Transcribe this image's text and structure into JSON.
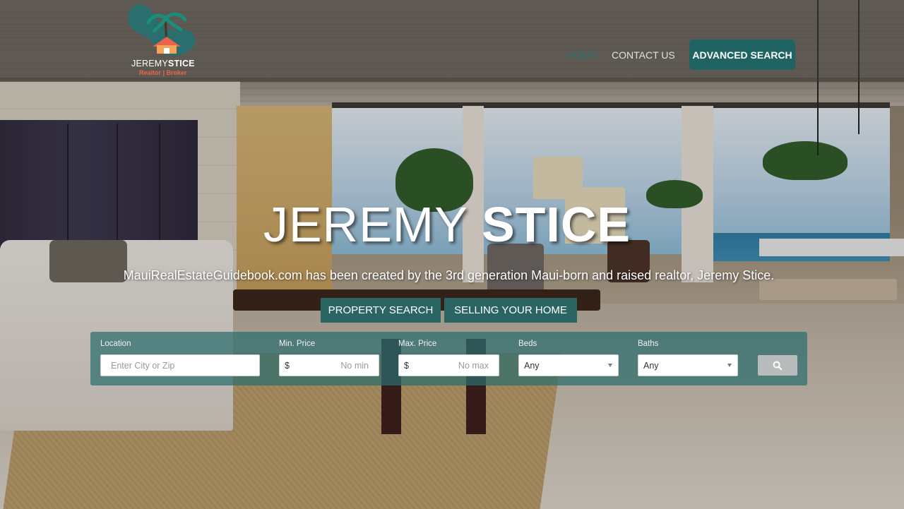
{
  "brand": {
    "logo_first": "JEREMY",
    "logo_last": "STICE",
    "logo_sub": "Realtor | Broker"
  },
  "nav": {
    "home": "HOME",
    "contact": "CONTACT US",
    "advanced_search": "ADVANCED SEARCH"
  },
  "hero": {
    "title_first": "JEREMY",
    "title_last": "STICE",
    "subtitle": "MauiRealEstateGuidebook.com has been created by the 3rd generation Maui-born and raised realtor, Jeremy Stice.",
    "buttons": [
      "PROPERTY SEARCH",
      "SELLING YOUR HOME"
    ]
  },
  "search": {
    "location_label": "Location",
    "location_placeholder": "Enter City or Zip",
    "min_label": "Min. Price",
    "min_currency": "$",
    "min_placeholder": "No min",
    "max_label": "Max. Price",
    "max_currency": "$",
    "max_placeholder": "No max",
    "beds_label": "Beds",
    "beds_value": "Any",
    "baths_label": "Baths",
    "baths_value": "Any",
    "submit_icon": "search-icon"
  },
  "colors": {
    "accent": "#1f6462",
    "nav_active": "#2d6f6d",
    "logo_sub": "#e8644a"
  }
}
